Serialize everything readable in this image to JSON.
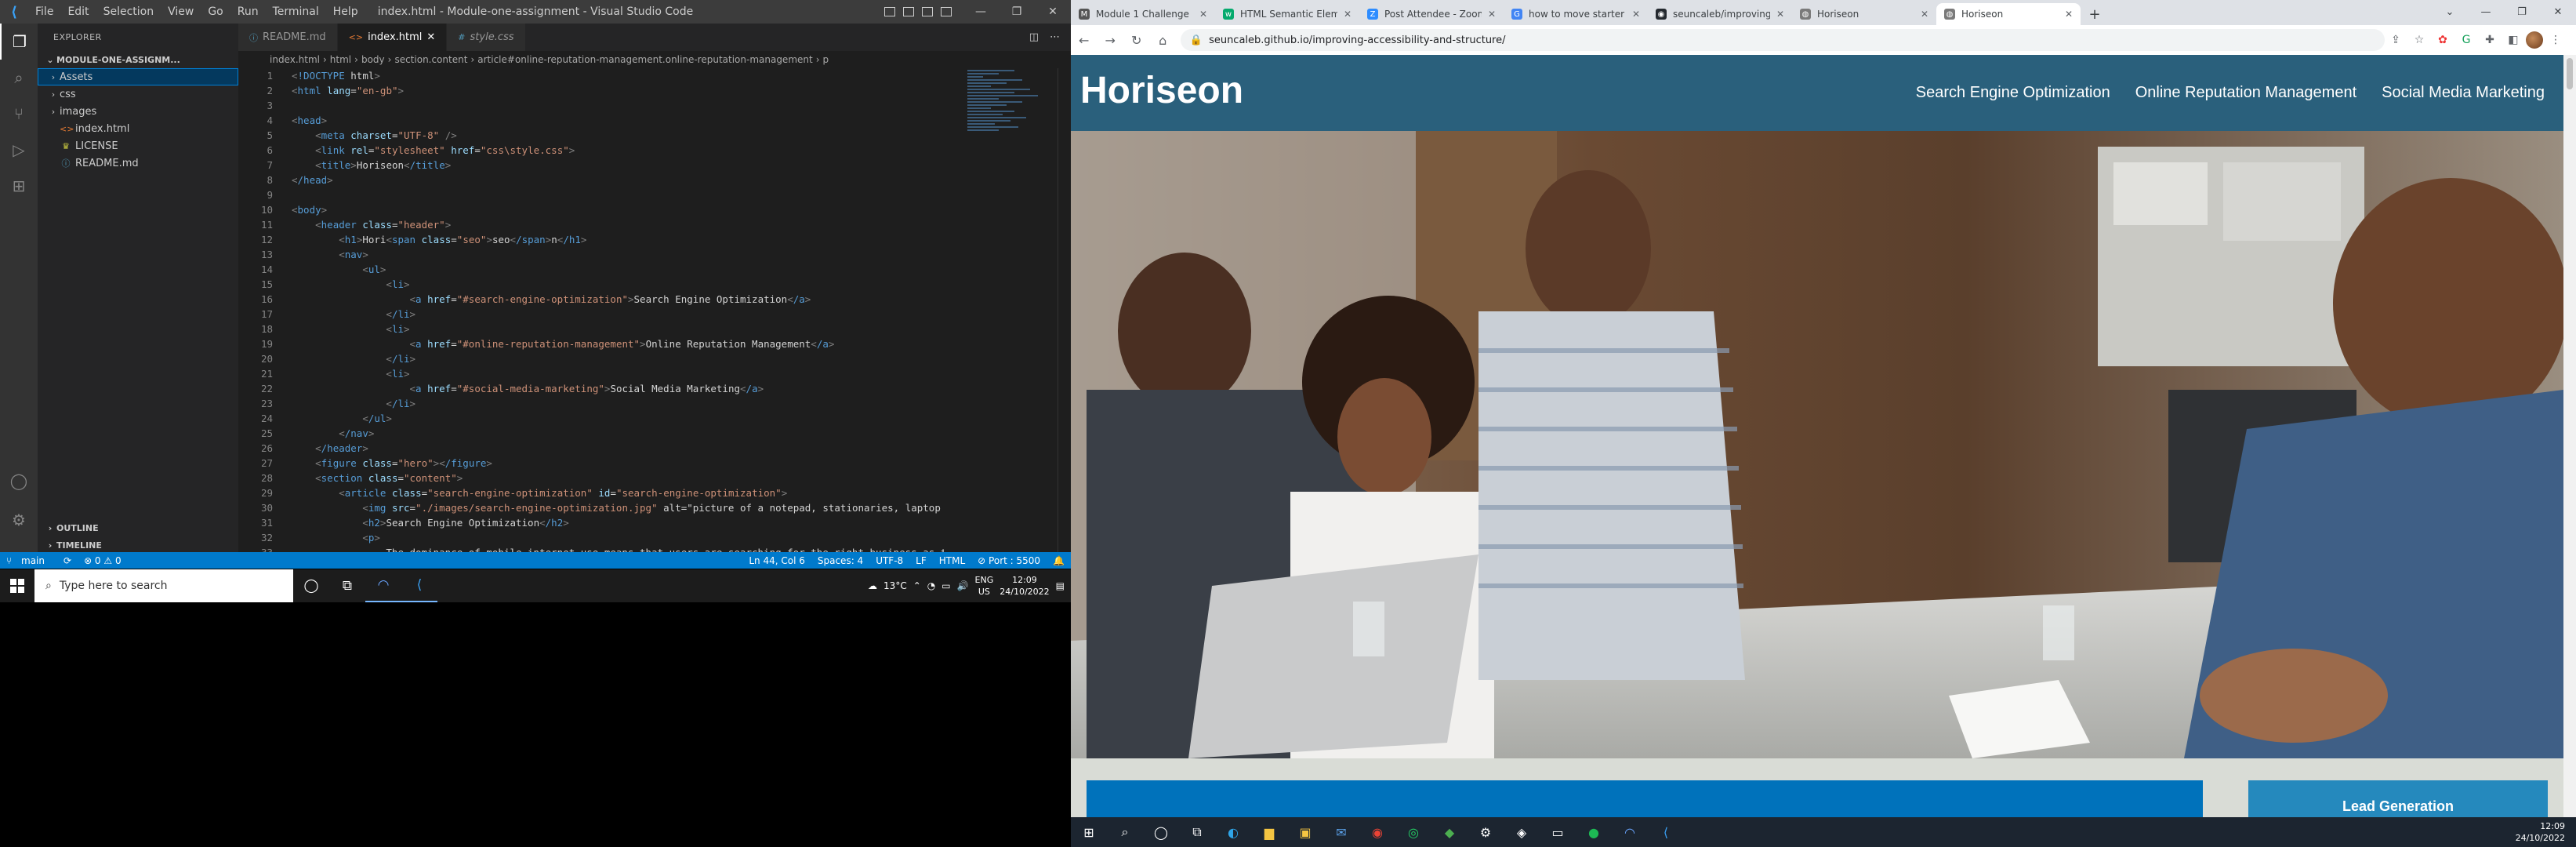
{
  "vscode": {
    "menu": [
      "File",
      "Edit",
      "Selection",
      "View",
      "Go",
      "Run",
      "Terminal",
      "Help"
    ],
    "title": "index.html - Module-one-assignment - Visual Studio Code",
    "explorer_header": "EXPLORER",
    "folder_name": "MODULE-ONE-ASSIGNM...",
    "tree": [
      {
        "label": "Assets",
        "type": "folder"
      },
      {
        "label": "css",
        "type": "folder"
      },
      {
        "label": "images",
        "type": "folder"
      },
      {
        "label": "index.html",
        "type": "html"
      },
      {
        "label": "LICENSE",
        "type": "license"
      },
      {
        "label": "README.md",
        "type": "md"
      }
    ],
    "outline_label": "OUTLINE",
    "timeline_label": "TIMELINE",
    "tabs": [
      {
        "label": "README.md",
        "icon": "i"
      },
      {
        "label": "index.html",
        "icon": "<>"
      },
      {
        "label": "style.css",
        "icon": "#"
      }
    ],
    "breadcrumb": [
      "index.html",
      "html",
      "body",
      "section.content",
      "article#online-reputation-management.online-reputation-management",
      "p"
    ],
    "code_lines": [
      "<!DOCTYPE html>",
      "<html lang=\"en-gb\">",
      "",
      "<head>",
      "    <meta charset=\"UTF-8\" />",
      "    <link rel=\"stylesheet\" href=\"css\\style.css\">",
      "    <title>Horiseon</title>",
      "</head>",
      "",
      "<body>",
      "    <header class=\"header\">",
      "        <h1>Hori<span class=\"seo\">seo</span>n</h1>",
      "        <nav>",
      "            <ul>",
      "                <li>",
      "                    <a href=\"#search-engine-optimization\">Search Engine Optimization</a>",
      "                </li>",
      "                <li>",
      "                    <a href=\"#online-reputation-management\">Online Reputation Management</a>",
      "                </li>",
      "                <li>",
      "                    <a href=\"#social-media-marketing\">Social Media Marketing</a>",
      "                </li>",
      "            </ul>",
      "        </nav>",
      "    </header>",
      "    <figure class=\"hero\"></figure>",
      "    <section class=\"content\">",
      "        <article class=\"search-engine-optimization\" id=\"search-engine-optimization\">",
      "            <img src=\"./images/search-engine-optimization.jpg\" alt=\"picture of a notepad, stationaries, laptop a",
      "            <h2>Search Engine Optimization</h2>",
      "            <p>",
      "                The dominance of mobile internet use means that users are searching for the right business as th"
    ],
    "status": {
      "branch": "main",
      "problems": "⊗ 0 ⚠ 0",
      "position": "Ln 44, Col 6",
      "spaces": "Spaces: 4",
      "encoding": "UTF-8",
      "eol": "LF",
      "language": "HTML",
      "port": "⊘ Port : 5500"
    }
  },
  "taskbar_left": {
    "search_placeholder": "Type here to search",
    "weather": "13°C",
    "lang_top": "ENG",
    "lang_bottom": "US",
    "time": "12:09",
    "date": "24/10/2022"
  },
  "chrome": {
    "tabs": [
      {
        "label": "Module 1 Challenge",
        "color": "#555555",
        "glyph": "M"
      },
      {
        "label": "HTML Semantic Elements",
        "color": "#04aa6d",
        "glyph": "w"
      },
      {
        "label": "Post Attendee - Zoom",
        "color": "#2d8cff",
        "glyph": "Z"
      },
      {
        "label": "how to move starter code to ne",
        "color": "#4285f4",
        "glyph": "G"
      },
      {
        "label": "seuncaleb/improving-accessibili",
        "color": "#24292f",
        "glyph": "◉"
      },
      {
        "label": "Horiseon",
        "color": "#7a7a7a",
        "glyph": "◍"
      },
      {
        "label": "Horiseon",
        "color": "#7a7a7a",
        "glyph": "◍"
      }
    ],
    "active_tab_index": 6,
    "url": "seuncaleb.github.io/improving-accessibility-and-structure/"
  },
  "site": {
    "logo": "Horiseon",
    "nav": [
      "Search Engine Optimization",
      "Online Reputation Management",
      "Social Media Marketing"
    ],
    "lead_heading": "Lead Generation",
    "header_color": "#2a607c",
    "content_color": "#0072bb",
    "lead_color": "#2589bd"
  },
  "taskbar_right": {
    "time": "12:09",
    "date": "24/10/2022"
  }
}
